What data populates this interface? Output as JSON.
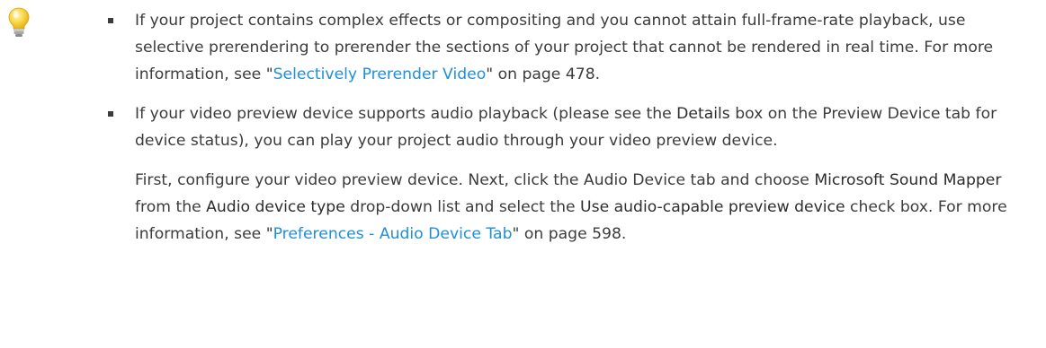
{
  "icon": {
    "name": "lightbulb-icon",
    "bulb_color": "#f7d53a",
    "base_color": "#b0b0b0"
  },
  "colors": {
    "text": "#3c3c3c",
    "link": "#1f8fd6"
  },
  "tips": [
    {
      "p1_pre": "If your project contains complex effects or compositing and you cannot attain full-frame-rate playback, use selective prerendering to prerender the sections of your project that cannot be rendered in real time. For more information, see \"",
      "p1_link": "Selectively Prerender Video",
      "p1_post": "\" on page 478."
    },
    {
      "p1_pre": "If your video preview device supports audio playback (please see the ",
      "p1_term": "Details",
      "p1_post": " box on the Preview Device tab for device status), you can play your project audio through your video preview device.",
      "p2_a": "First, configure your video preview device. Next, click the Audio Device tab and choose ",
      "p2_term1": "Microsoft Sound Mapper",
      "p2_b": " from the ",
      "p2_term2": "Audio device type",
      "p2_c": " drop-down list and select the ",
      "p2_term3": "Use audio-capable preview device",
      "p2_d": " check box. For more information, see \"",
      "p2_link": "Preferences - Audio Device Tab",
      "p2_e": "\" on page 598."
    }
  ]
}
